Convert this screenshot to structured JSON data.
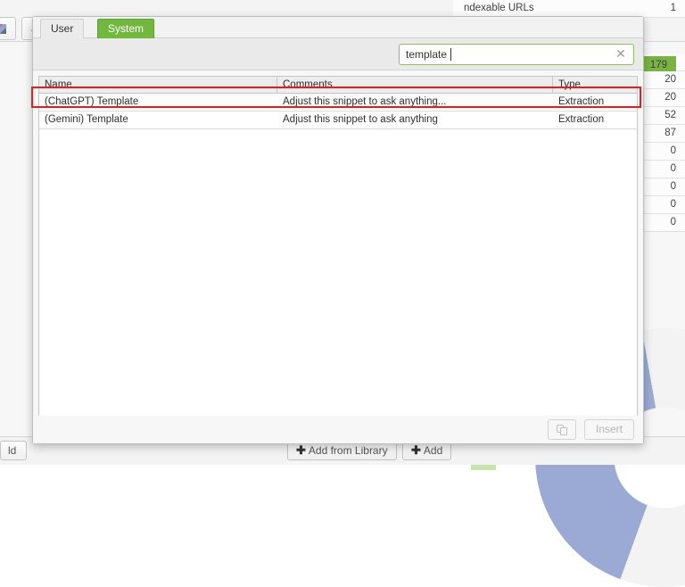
{
  "background": {
    "toolbar_buttons": [
      {
        "name": "color-swatch-tool",
        "glyph": ""
      },
      {
        "name": "comment-slashes-tool",
        "glyph": "//"
      }
    ],
    "sheet_rows": [
      {
        "label": "ndexable URLs",
        "value": "1",
        "highlight": false
      },
      {
        "label": "",
        "value": "179",
        "highlight": true
      },
      {
        "label": "",
        "value": "20",
        "highlight": false
      },
      {
        "label": "",
        "value": "20",
        "highlight": false
      },
      {
        "label": "",
        "value": "52",
        "highlight": false
      },
      {
        "label": "",
        "value": "87",
        "highlight": false
      },
      {
        "label": "",
        "value": "0",
        "highlight": false
      },
      {
        "label": "",
        "value": "0",
        "highlight": false
      },
      {
        "label": "",
        "value": "0",
        "highlight": false
      },
      {
        "label": "",
        "value": "0",
        "highlight": false
      },
      {
        "label": "",
        "value": "0",
        "highlight": false
      }
    ],
    "bottom_bar": {
      "field_button_label": "ld",
      "add_from_library_label": "Add from Library",
      "add_label": "Add",
      "plus_glyph": "✚"
    }
  },
  "modal": {
    "tabs": [
      {
        "label": "User",
        "active": false
      },
      {
        "label": "System",
        "active": true
      }
    ],
    "search": {
      "value": "template",
      "placeholder": "",
      "clear_glyph": "✕"
    },
    "table": {
      "columns": [
        "Name",
        "Comments",
        "Type"
      ],
      "rows": [
        {
          "name": "(ChatGPT) Template",
          "comments": "Adjust this snippet to ask anything...",
          "type": "Extraction"
        },
        {
          "name": "(Gemini) Template",
          "comments": "Adjust this snippet to ask anything",
          "type": "Extraction"
        }
      ]
    },
    "footer": {
      "duplicate_label": "",
      "insert_label": "Insert"
    }
  },
  "colors": {
    "accent_green": "#72b83e",
    "highlight_red": "#e81c1c",
    "cell_green": "#79b443",
    "donut_blue": "#9aaad4"
  }
}
